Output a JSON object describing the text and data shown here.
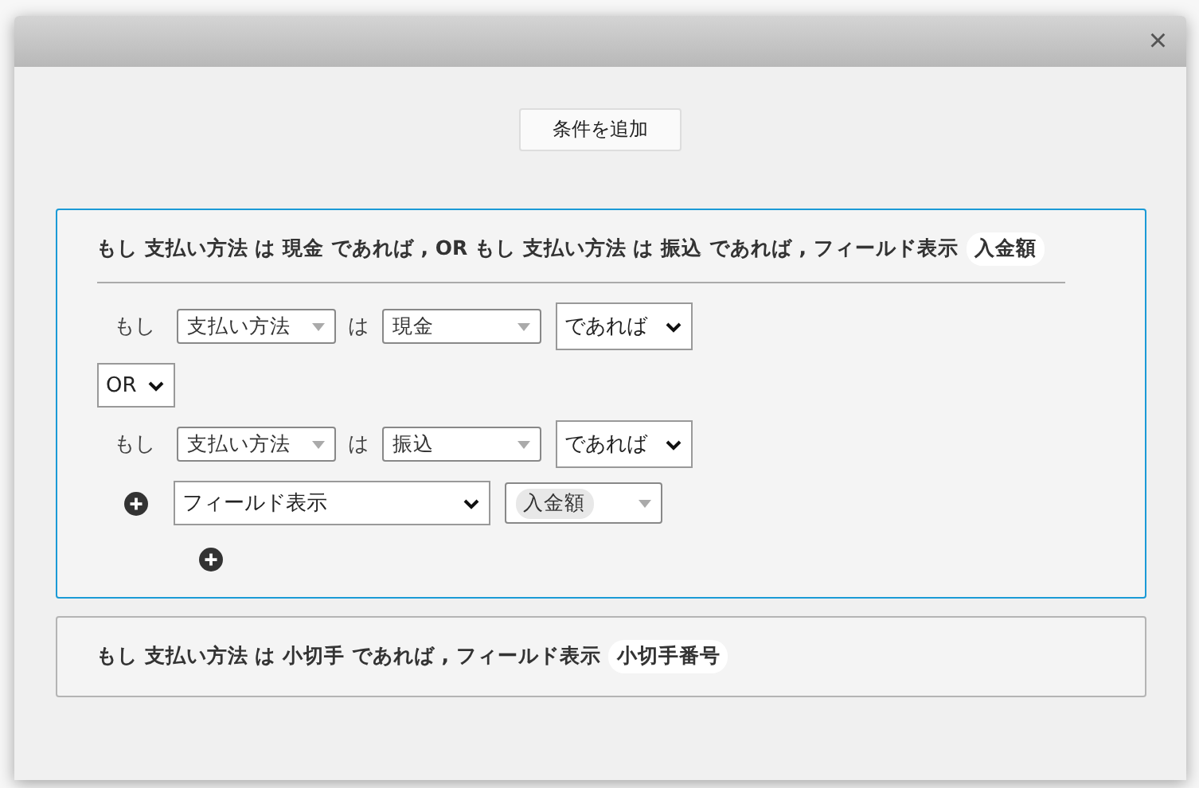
{
  "dialog": {
    "close": "×",
    "add_button": "条件を追加"
  },
  "rules": [
    {
      "expanded": true,
      "summary": "もし 支払い方法 は 現金 であれば , OR もし 支払い方法 は 振込 であれば , フィールド表示",
      "chip": "入金額",
      "rows": [
        {
          "kind": "condition",
          "if": "もし",
          "field": "支払い方法",
          "is": "は",
          "value": "現金",
          "op": "であれば"
        },
        {
          "kind": "operator",
          "value": "OR"
        },
        {
          "kind": "condition",
          "if": "もし",
          "field": "支払い方法",
          "is": "は",
          "value": "振込",
          "op": "であれば"
        },
        {
          "kind": "action",
          "action": "フィールド表示",
          "target": "入金額"
        },
        {
          "kind": "add"
        }
      ]
    },
    {
      "expanded": false,
      "summary": "もし 支払い方法 は 小切手 であれば , フィールド表示",
      "chip": "小切手番号"
    }
  ]
}
